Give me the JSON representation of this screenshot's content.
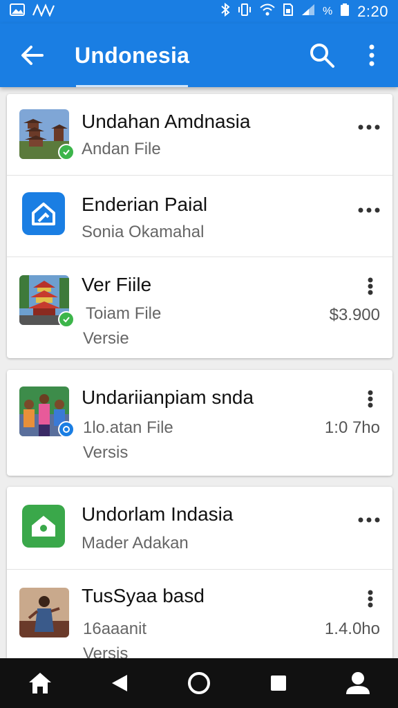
{
  "status_bar": {
    "time": "2:20",
    "icons": [
      "image-icon",
      "signal-wave-icon",
      "bluetooth-icon",
      "vibrate-icon",
      "wifi-icon",
      "sim-icon",
      "cell-signal-icon",
      "percent-icon",
      "battery-icon"
    ]
  },
  "app_bar": {
    "title": "Undonesia",
    "back_icon": "arrow-back-icon",
    "search_icon": "search-icon",
    "menu_icon": "more-vert-icon",
    "color": "#1a7ee3"
  },
  "items": [
    {
      "title": "Undahan Amdnasia",
      "subtitle": "Andan File",
      "extra": "",
      "amount": "",
      "thumb": "temple-photo",
      "badge": "check-green"
    },
    {
      "title": "Enderian Paial",
      "subtitle": "Sonia Okamahal",
      "extra": "",
      "amount": "",
      "thumb": "blue-house-app-icon",
      "badge": ""
    },
    {
      "title": "Ver Fiile",
      "subtitle": "Toiam File",
      "extra": "Versie",
      "amount": "$3.900",
      "thumb": "red-temple-photo",
      "badge": "check-green"
    },
    {
      "title": "Undariianpiam snda",
      "subtitle": "1lo.atan File",
      "extra": "Versis",
      "amount": "1:0 7ho",
      "thumb": "children-photo",
      "badge": "check-blue"
    },
    {
      "title": "Undorlam Indasia",
      "subtitle": "Mader Adakan",
      "extra": "",
      "amount": "",
      "thumb": "green-house-app-icon",
      "badge": ""
    },
    {
      "title": "TusSyaa basd",
      "subtitle": "16aaanit",
      "extra": "Versis",
      "amount": "1.4.0ho",
      "thumb": "dancer-photo",
      "badge": ""
    }
  ],
  "nav_bar": {
    "buttons": [
      "home-icon",
      "back-triangle-icon",
      "home-circle-icon",
      "recents-square-icon",
      "profile-icon"
    ]
  }
}
